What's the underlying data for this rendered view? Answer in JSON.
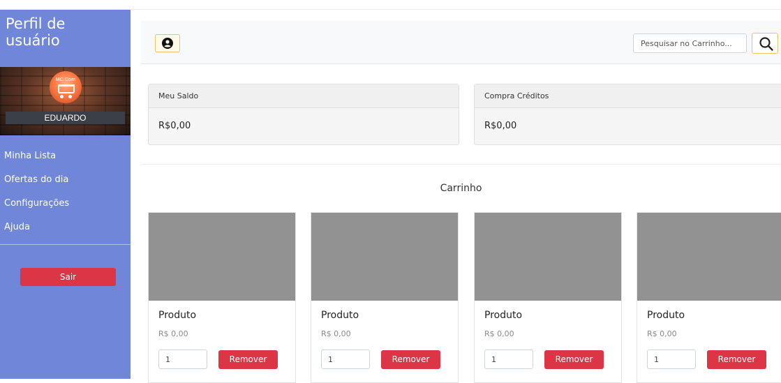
{
  "sidebar": {
    "title": "Perfil de usuário",
    "logo_text": "MC.Com",
    "user_name": "EDUARDO",
    "items": [
      {
        "label": "Minha Lista"
      },
      {
        "label": "Ofertas do dia"
      },
      {
        "label": "Configurações"
      },
      {
        "label": "Ajuda"
      }
    ],
    "logout_label": "Sair"
  },
  "header": {
    "user_icon": "user-circle-icon",
    "search_placeholder": "Pesquisar no Carrinho...",
    "search_icon": "search-icon"
  },
  "balance": [
    {
      "label": "Meu Saldo",
      "value": "R$0,00"
    },
    {
      "label": "Compra Créditos",
      "value": "R$0,00"
    }
  ],
  "cart": {
    "title": "Carrinho",
    "products": [
      {
        "name": "Produto",
        "price": "R$ 0,00",
        "quantity": "1",
        "remove_label": "Remover"
      },
      {
        "name": "Produto",
        "price": "R$ 0,00",
        "quantity": "1",
        "remove_label": "Remover"
      },
      {
        "name": "Produto",
        "price": "R$ 0,00",
        "quantity": "1",
        "remove_label": "Remover"
      },
      {
        "name": "Produto",
        "price": "R$ 0,00",
        "quantity": "1",
        "remove_label": "Remover"
      }
    ]
  },
  "colors": {
    "sidebar": "#6f86d9",
    "danger": "#dc3545",
    "accent_border": "#e9c46a",
    "product_placeholder": "#929292"
  }
}
